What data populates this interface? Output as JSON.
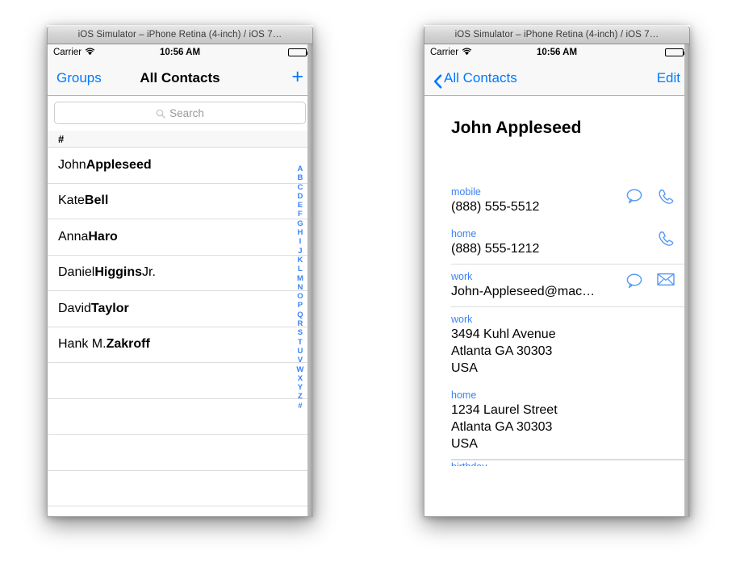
{
  "window": {
    "title": "iOS Simulator – iPhone Retina (4-inch) / iOS 7…"
  },
  "status_bar": {
    "carrier": "Carrier",
    "wifi_icon": "wifi-icon",
    "time": "10:56 AM",
    "battery_icon": "battery-full-icon"
  },
  "colors": {
    "ios_blue": "#007aff",
    "label_blue": "#3a82f7",
    "bar_background": "#f8f8f8",
    "separator": "#dcdcdc"
  },
  "left_panel": {
    "nav": {
      "left_label": "Groups",
      "title": "All Contacts",
      "right_icon": "plus-icon"
    },
    "search": {
      "icon": "search-icon",
      "placeholder": "Search",
      "value": ""
    },
    "section_header": "#",
    "contacts": [
      {
        "first": "John ",
        "last": "Appleseed",
        "suffix": ""
      },
      {
        "first": "Kate ",
        "last": "Bell",
        "suffix": ""
      },
      {
        "first": "Anna ",
        "last": "Haro",
        "suffix": ""
      },
      {
        "first": "Daniel ",
        "last": "Higgins",
        "suffix": " Jr."
      },
      {
        "first": "David ",
        "last": "Taylor",
        "suffix": ""
      },
      {
        "first": "Hank M. ",
        "last": "Zakroff",
        "suffix": ""
      }
    ],
    "empty_row_count": 4,
    "index_letters": [
      "A",
      "B",
      "C",
      "D",
      "E",
      "F",
      "G",
      "H",
      "I",
      "J",
      "K",
      "L",
      "M",
      "N",
      "O",
      "P",
      "Q",
      "R",
      "S",
      "T",
      "U",
      "V",
      "W",
      "X",
      "Y",
      "Z",
      "#"
    ]
  },
  "right_panel": {
    "nav": {
      "back_icon": "chevron-left-icon",
      "back_label": "All Contacts",
      "right_label": "Edit"
    },
    "contact_name": "John Appleseed",
    "fields": [
      {
        "label": "mobile",
        "value": "(888) 555-5512",
        "multiline": false,
        "actions": [
          "message-bubble-icon",
          "phone-icon"
        ],
        "separator_below": false
      },
      {
        "label": "home",
        "value": "(888) 555-1212",
        "multiline": false,
        "actions": [
          "phone-icon"
        ],
        "separator_below": true
      },
      {
        "label": "work",
        "value": "John-Appleseed@mac…",
        "multiline": false,
        "actions": [
          "message-bubble-icon",
          "envelope-icon"
        ],
        "separator_below": true
      },
      {
        "label": "work",
        "value": "3494 Kuhl Avenue\nAtlanta GA 30303\nUSA",
        "multiline": true,
        "actions": [],
        "separator_below": false
      },
      {
        "label": "home",
        "value": "1234 Laurel Street\nAtlanta GA 30303\nUSA",
        "multiline": true,
        "actions": [],
        "separator_below": true
      }
    ],
    "cut_off_label": "birthday"
  }
}
